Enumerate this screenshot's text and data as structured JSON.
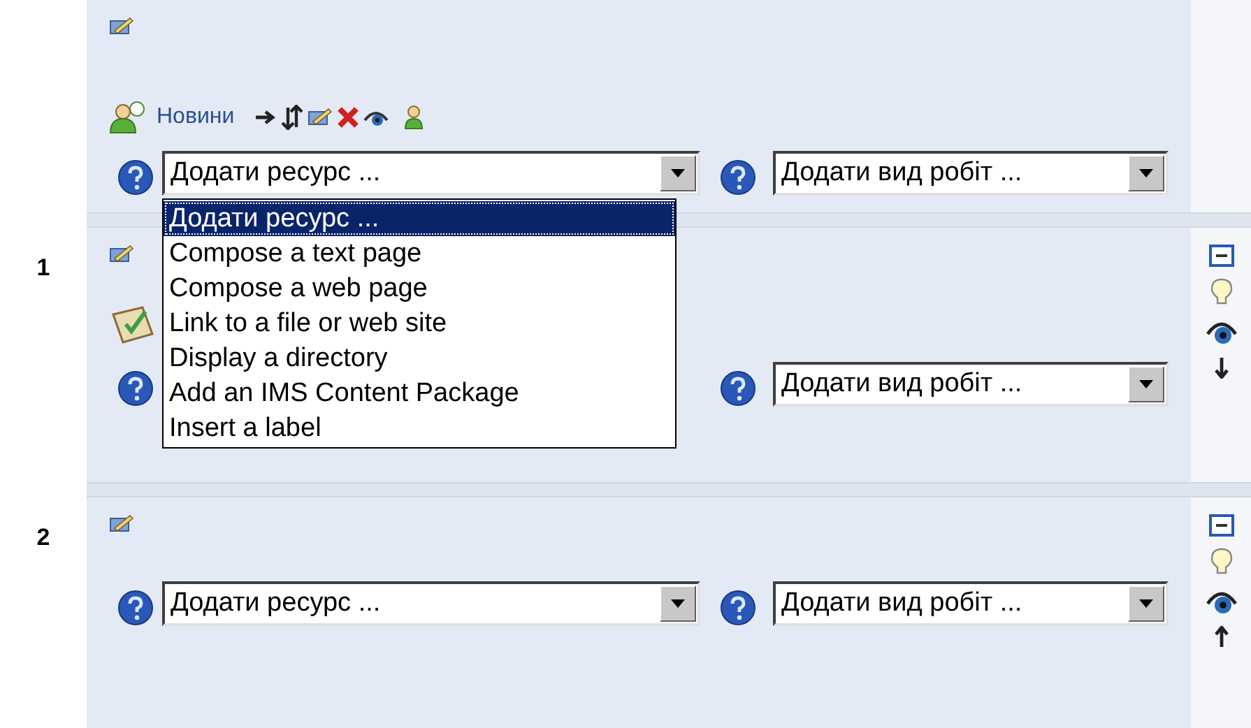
{
  "sections": [
    {
      "activity": {
        "kind": "forum",
        "title": "Новини"
      },
      "resource_select": {
        "value": "Додати ресурс ...",
        "open": true,
        "options": [
          {
            "label": "Додати ресурс ...",
            "selected": true
          },
          {
            "label": "Compose a text page",
            "selected": false
          },
          {
            "label": "Compose a web page",
            "selected": false
          },
          {
            "label": "Link to a file or web site",
            "selected": false
          },
          {
            "label": "Display a directory",
            "selected": false
          },
          {
            "label": "Add an IMS Content Package",
            "selected": false
          },
          {
            "label": "Insert a label",
            "selected": false
          }
        ]
      },
      "activity_select": {
        "value": "Додати вид робіт ..."
      }
    },
    {
      "number": "1",
      "activity": {
        "kind": "assignment"
      },
      "activity_select": {
        "value": "Додати вид робіт ..."
      },
      "controls": [
        {
          "kind": "collapse"
        },
        {
          "kind": "highlight"
        },
        {
          "kind": "visibility"
        },
        {
          "kind": "move_down"
        }
      ]
    },
    {
      "number": "2",
      "resource_select": {
        "value": "Додати ресурс ...",
        "open": false
      },
      "activity_select": {
        "value": "Додати вид робіт ..."
      },
      "controls": [
        {
          "kind": "collapse"
        },
        {
          "kind": "highlight"
        },
        {
          "kind": "visibility"
        },
        {
          "kind": "move_up"
        }
      ]
    }
  ]
}
